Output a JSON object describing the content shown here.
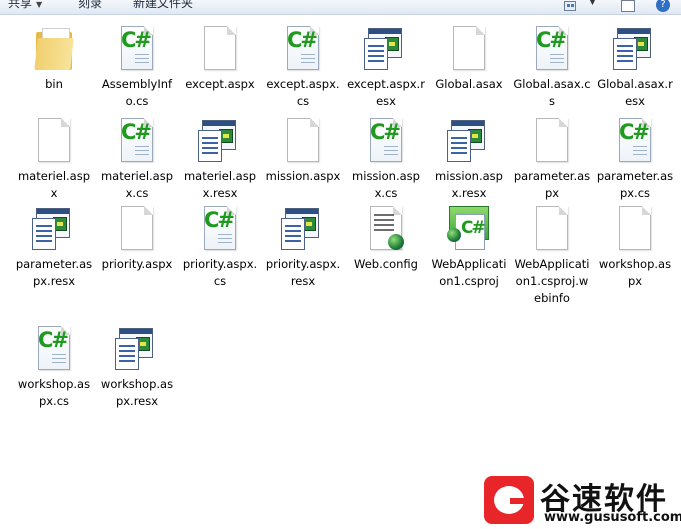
{
  "toolbar": {
    "share_label": "共享",
    "burn_label": "刻录",
    "new_folder_label": "新建文件夹"
  },
  "files": [
    {
      "name": "bin",
      "type": "folder"
    },
    {
      "name": "AssemblyInfo.cs",
      "type": "cs"
    },
    {
      "name": "except.aspx",
      "type": "generic"
    },
    {
      "name": "except.aspx.cs",
      "type": "cs"
    },
    {
      "name": "except.aspx.resx",
      "type": "resx"
    },
    {
      "name": "Global.asax",
      "type": "generic"
    },
    {
      "name": "Global.asax.cs",
      "type": "cs"
    },
    {
      "name": "Global.asax.resx",
      "type": "resx"
    },
    {
      "name": "materiel.aspx",
      "type": "generic"
    },
    {
      "name": "materiel.aspx.cs",
      "type": "cs"
    },
    {
      "name": "materiel.aspx.resx",
      "type": "resx"
    },
    {
      "name": "mission.aspx",
      "type": "generic"
    },
    {
      "name": "mission.aspx.cs",
      "type": "cs"
    },
    {
      "name": "mission.aspx.resx",
      "type": "resx"
    },
    {
      "name": "parameter.aspx",
      "type": "generic"
    },
    {
      "name": "parameter.aspx.cs",
      "type": "cs"
    },
    {
      "name": "parameter.aspx.resx",
      "type": "resx"
    },
    {
      "name": "priority.aspx",
      "type": "generic"
    },
    {
      "name": "priority.aspx.cs",
      "type": "cs"
    },
    {
      "name": "priority.aspx.resx",
      "type": "resx"
    },
    {
      "name": "Web.config",
      "type": "config"
    },
    {
      "name": "WebApplication1.csproj",
      "type": "csproj"
    },
    {
      "name": "WebApplication1.csproj.webinfo",
      "type": "generic"
    },
    {
      "name": "workshop.aspx",
      "type": "generic"
    },
    {
      "name": "workshop.aspx.cs",
      "type": "cs"
    },
    {
      "name": "workshop.aspx.resx",
      "type": "resx"
    }
  ],
  "watermark": {
    "brand": "谷速软件",
    "url": "www.gususoft.com",
    "brand_color": "#e8262a"
  }
}
